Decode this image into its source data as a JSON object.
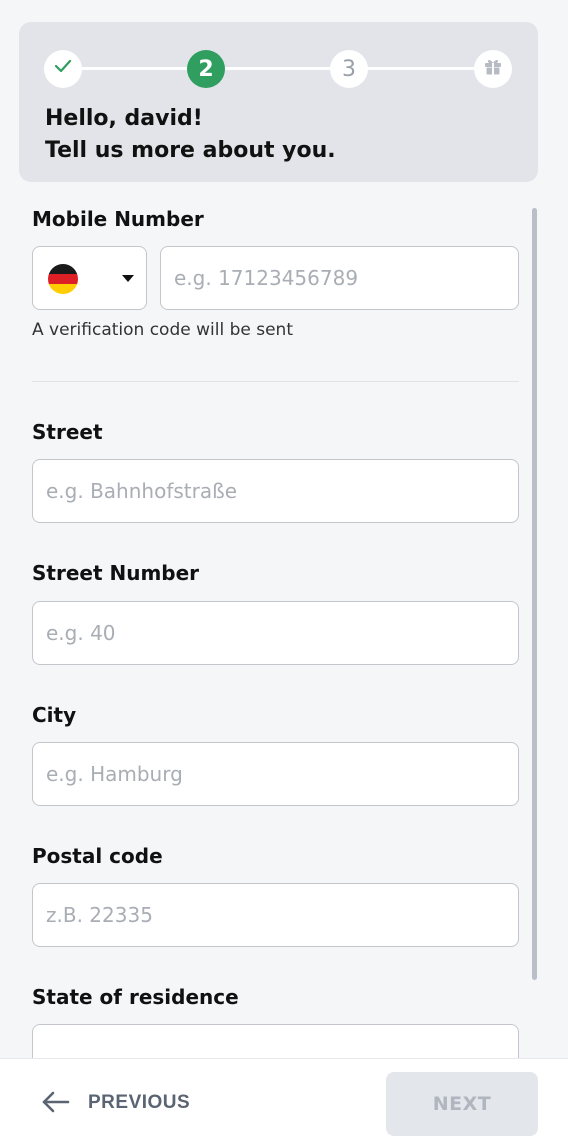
{
  "stepper": {
    "steps": [
      {
        "state": "completed",
        "icon": "check-icon"
      },
      {
        "state": "current",
        "label": "2"
      },
      {
        "state": "upcoming",
        "label": "3"
      },
      {
        "state": "upcoming",
        "icon": "gift-icon"
      }
    ],
    "accent_color": "#2f9e5e"
  },
  "header": {
    "greeting_line1": "Hello, david!",
    "greeting_line2": "Tell us more about you."
  },
  "form": {
    "mobile": {
      "label": "Mobile Number",
      "country_flag": "germany-flag-icon",
      "placeholder": "e.g. 17123456789",
      "hint": "A verification code will be sent"
    },
    "street": {
      "label": "Street",
      "placeholder": "e.g. Bahnhofstraße"
    },
    "street_number": {
      "label": "Street Number",
      "placeholder": "e.g. 40"
    },
    "city": {
      "label": "City",
      "placeholder": "e.g. Hamburg"
    },
    "postal_code": {
      "label": "Postal code",
      "placeholder": "z.B. 22335"
    },
    "state": {
      "label": "State of residence"
    }
  },
  "footer": {
    "previous_label": "PREVIOUS",
    "next_label": "NEXT"
  }
}
